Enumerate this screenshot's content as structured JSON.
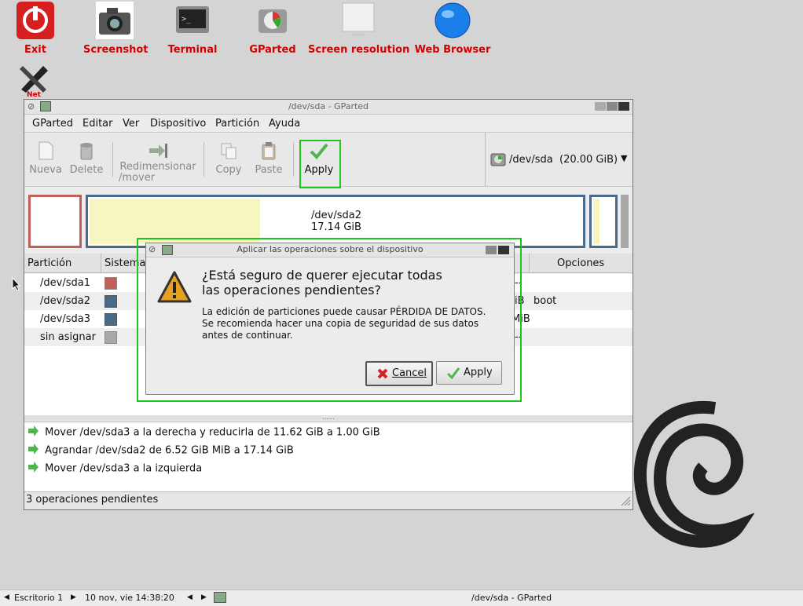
{
  "desktop": {
    "icons": [
      {
        "label": "Exit"
      },
      {
        "label": "Screenshot"
      },
      {
        "label": "Terminal"
      },
      {
        "label": "GParted"
      },
      {
        "label": "Screen resolution"
      },
      {
        "label": "Web Browser"
      },
      {
        "label": "Net"
      }
    ]
  },
  "window": {
    "title": "/dev/sda - GParted",
    "menu": [
      "GParted",
      "Editar",
      "Ver",
      "Dispositivo",
      "Partición",
      "Ayuda"
    ],
    "toolbar": {
      "new": "Nueva",
      "delete": "Delete",
      "resize_line1": "Redimensionar",
      "resize_line2": "/mover",
      "copy": "Copy",
      "paste": "Paste",
      "apply": "Apply"
    },
    "device": {
      "name": "/dev/sda",
      "size": "(20.00 GiB)"
    },
    "graph": {
      "label": "/dev/sda2",
      "size": "17.14 GiB"
    },
    "table": {
      "headers": {
        "partition": "Partición",
        "fs": "Sistema",
        "flags": "Opciones"
      },
      "rows": [
        {
          "name": "/dev/sda1",
          "color": "#c0605a",
          "tail": "--"
        },
        {
          "name": "/dev/sda2",
          "color": "#4a6a8a",
          "tail": "iB",
          "flags": "boot"
        },
        {
          "name": "/dev/sda3",
          "color": "#4a6a8a",
          "tail": "MiB"
        },
        {
          "name": "sin asignar",
          "color": "#a8a8a8",
          "tail": "--"
        }
      ]
    },
    "operations": [
      "Mover /dev/sda3 a la derecha y reducirla de 11.62 GiB a 1.00 GiB",
      "Agrandar /dev/sda2 de 6.52 GiB MiB a 17.14 GiB",
      "Mover /dev/sda3 a la izquierda"
    ],
    "status": "3 operaciones pendientes"
  },
  "dialog": {
    "title": "Aplicar las operaciones sobre el dispositivo",
    "heading_line1": "¿Está seguro de querer ejecutar todas",
    "heading_line2": "las operaciones pendientes?",
    "body_line1": "La edición de particiones puede causar PÉRDIDA DE DATOS.",
    "body_line2": "Se recomienda hacer una copia de seguridad de sus datos",
    "body_line3": "antes de continuar.",
    "cancel": "Cancel",
    "apply": "Apply"
  },
  "taskbar": {
    "desktop": "Escritorio 1",
    "datetime": "10 nov, vie 14:38:20",
    "task": "/dev/sda - GParted"
  }
}
